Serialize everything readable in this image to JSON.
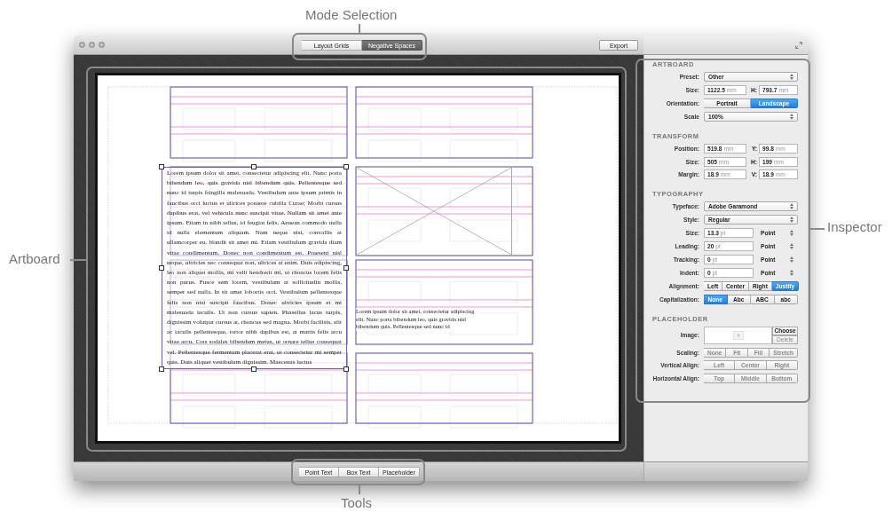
{
  "annotations": [
    {
      "label": "Mode Selection"
    },
    {
      "label": "Artboard"
    },
    {
      "label": "Inspector"
    },
    {
      "label": "Tools"
    }
  ],
  "toolbar": {
    "modes": [
      {
        "label": "Layout Grids",
        "selected": false
      },
      {
        "label": "Negative Spaces",
        "selected": true
      }
    ],
    "export_button": "Export"
  },
  "artboard": {
    "text_frame": "Lorem ipsum dolor sit amet, consectetur adipiscing elit. Nunc porta bibendum leo, quis gravida nisl bibendum quis. Pellentesque sed nunc id turpis fringilla malesuada. Vestibulum ante ipsum primis in faucibus orci luctus et ultrices posuere cubilia Curae; Morbi cursus dapibus erat, vel vehicula nunc suscipit vitae. Nullam sit amet ante ipsum. Etiam in nibh tellus, id feugiat felis. Aenean commodo nulla id nulla elementum aliquam. Nam neque nisi, convallis at ullamcorper eu, blandit sit amet mi. Etiam vestibulum gravida diam vitae condimentum. Donec non condimentum est. Praesent nisl neque, ultricies nec consequat non, ultrices at enim. Duis adipiscing, leo non aliquet mollis, mi velit hendrerit mi, ut rhoncus lorem felis non purus. Fusce sem lorem, vestibulum at sollicitudin mollis, semper sed nulla. In sit amet lobortis orci. Vestibulum pellentesque felis non nisi suscipit faucibus. Donec ultricies ipsum et mi malesuada iaculis. Ut non cursus sapien. Phasellus lacus turpis, dignissim volutpat cursus at, rhoncus sed magna. Morbi facilisis, elit ac iaculis pellentesque, tortor nibh dapibus est, at mattis felis arcu vitae arcu. Cras sodales bibendum metus, ut ornare tellus consequat vel. Pellentesque fermentum placerat erat, ut consectetur mi semper quis. Duis aliquet vestibulum dignissim. Maecenas luctus",
    "point_text": "Lorem ipsum dolor sit amet, consectetur adipiscing elit. Nunc porta bibendum leo, quis gravida nisl bibendum quis. Pellentesque sed nunc id"
  },
  "inspector": {
    "sections": [
      {
        "title": "ARTBOARD",
        "rows": [
          {
            "kind": "select",
            "label": "Preset:",
            "value": "Other"
          },
          {
            "kind": "pair",
            "label": "Size:",
            "value": "1122.5",
            "unit": "mm",
            "label2": "H:",
            "value2": "793.7",
            "unit2": "mm"
          },
          {
            "kind": "segmented",
            "label": "Orientation:",
            "disabled": false,
            "options": [
              {
                "label": "Portrait",
                "selected": false
              },
              {
                "label": "Landscape",
                "selected": true
              }
            ]
          },
          {
            "kind": "select",
            "label": "Scale",
            "value": "100%"
          }
        ]
      },
      {
        "title": "TRANSFORM",
        "rows": [
          {
            "kind": "pair",
            "label": "Position:",
            "value": "519.8",
            "unit": "mm",
            "label2": "Y:",
            "value2": "99.8",
            "unit2": "mm"
          },
          {
            "kind": "pair",
            "label": "Size:",
            "value": "505",
            "unit": "mm",
            "label2": "H:",
            "value2": "199",
            "unit2": "mm"
          },
          {
            "kind": "pair",
            "label": "Margin:",
            "value": "18.9",
            "unit": "mm",
            "label2": "V:",
            "value2": "18.9",
            "unit2": "mm"
          }
        ]
      },
      {
        "title": "TYPOGRAPHY",
        "rows": [
          {
            "kind": "select",
            "label": "Typeface:",
            "value": "Adobe Garamond"
          },
          {
            "kind": "select",
            "label": "Style:",
            "value": "Regular"
          },
          {
            "kind": "unit",
            "label": "Size:",
            "value": "13.3",
            "unit": "pt",
            "select": "Point"
          },
          {
            "kind": "unit",
            "label": "Leading:",
            "value": "20",
            "unit": "pt",
            "select": "Point"
          },
          {
            "kind": "unit",
            "label": "Tracking:",
            "value": "0",
            "unit": "pt",
            "select": "Point"
          },
          {
            "kind": "unit",
            "label": "Indent:",
            "value": "0",
            "unit": "pt",
            "select": "Point"
          },
          {
            "kind": "segmented",
            "label": "Alignment:",
            "disabled": false,
            "options": [
              {
                "label": "Left",
                "selected": false
              },
              {
                "label": "Center",
                "selected": false
              },
              {
                "label": "Right",
                "selected": false
              },
              {
                "label": "Justify",
                "selected": true
              }
            ]
          },
          {
            "kind": "segmented",
            "label": "Capitalization:",
            "disabled": false,
            "options": [
              {
                "label": "None",
                "selected": true
              },
              {
                "label": "Abc",
                "selected": false
              },
              {
                "label": "ABC",
                "selected": false
              },
              {
                "label": "abc",
                "selected": false
              }
            ]
          }
        ]
      },
      {
        "title": "PLACEHOLDER",
        "rows": [
          {
            "kind": "image",
            "label": "Image:",
            "buttons": [
              {
                "label": "Choose",
                "disabled": false
              },
              {
                "label": "Delete",
                "disabled": true
              }
            ]
          },
          {
            "kind": "segmented",
            "label": "Scaling:",
            "disabled": true,
            "options": [
              {
                "label": "None",
                "selected": false
              },
              {
                "label": "Fit",
                "selected": false
              },
              {
                "label": "Fill",
                "selected": false
              },
              {
                "label": "Stretch",
                "selected": false
              }
            ]
          },
          {
            "kind": "segmented",
            "label": "Vertical Align:",
            "disabled": true,
            "options": [
              {
                "label": "Left",
                "selected": false
              },
              {
                "label": "Center",
                "selected": false
              },
              {
                "label": "Right",
                "selected": false
              }
            ]
          },
          {
            "kind": "segmented",
            "label": "Horizontal Align:",
            "disabled": true,
            "options": [
              {
                "label": "Top",
                "selected": false
              },
              {
                "label": "Middle",
                "selected": false
              },
              {
                "label": "Bottom",
                "selected": false
              }
            ]
          }
        ]
      }
    ]
  },
  "tools": [
    {
      "label": "Point Text",
      "selected": false
    },
    {
      "label": "Box Text",
      "selected": false
    },
    {
      "label": "Placeholder",
      "selected": false
    }
  ]
}
